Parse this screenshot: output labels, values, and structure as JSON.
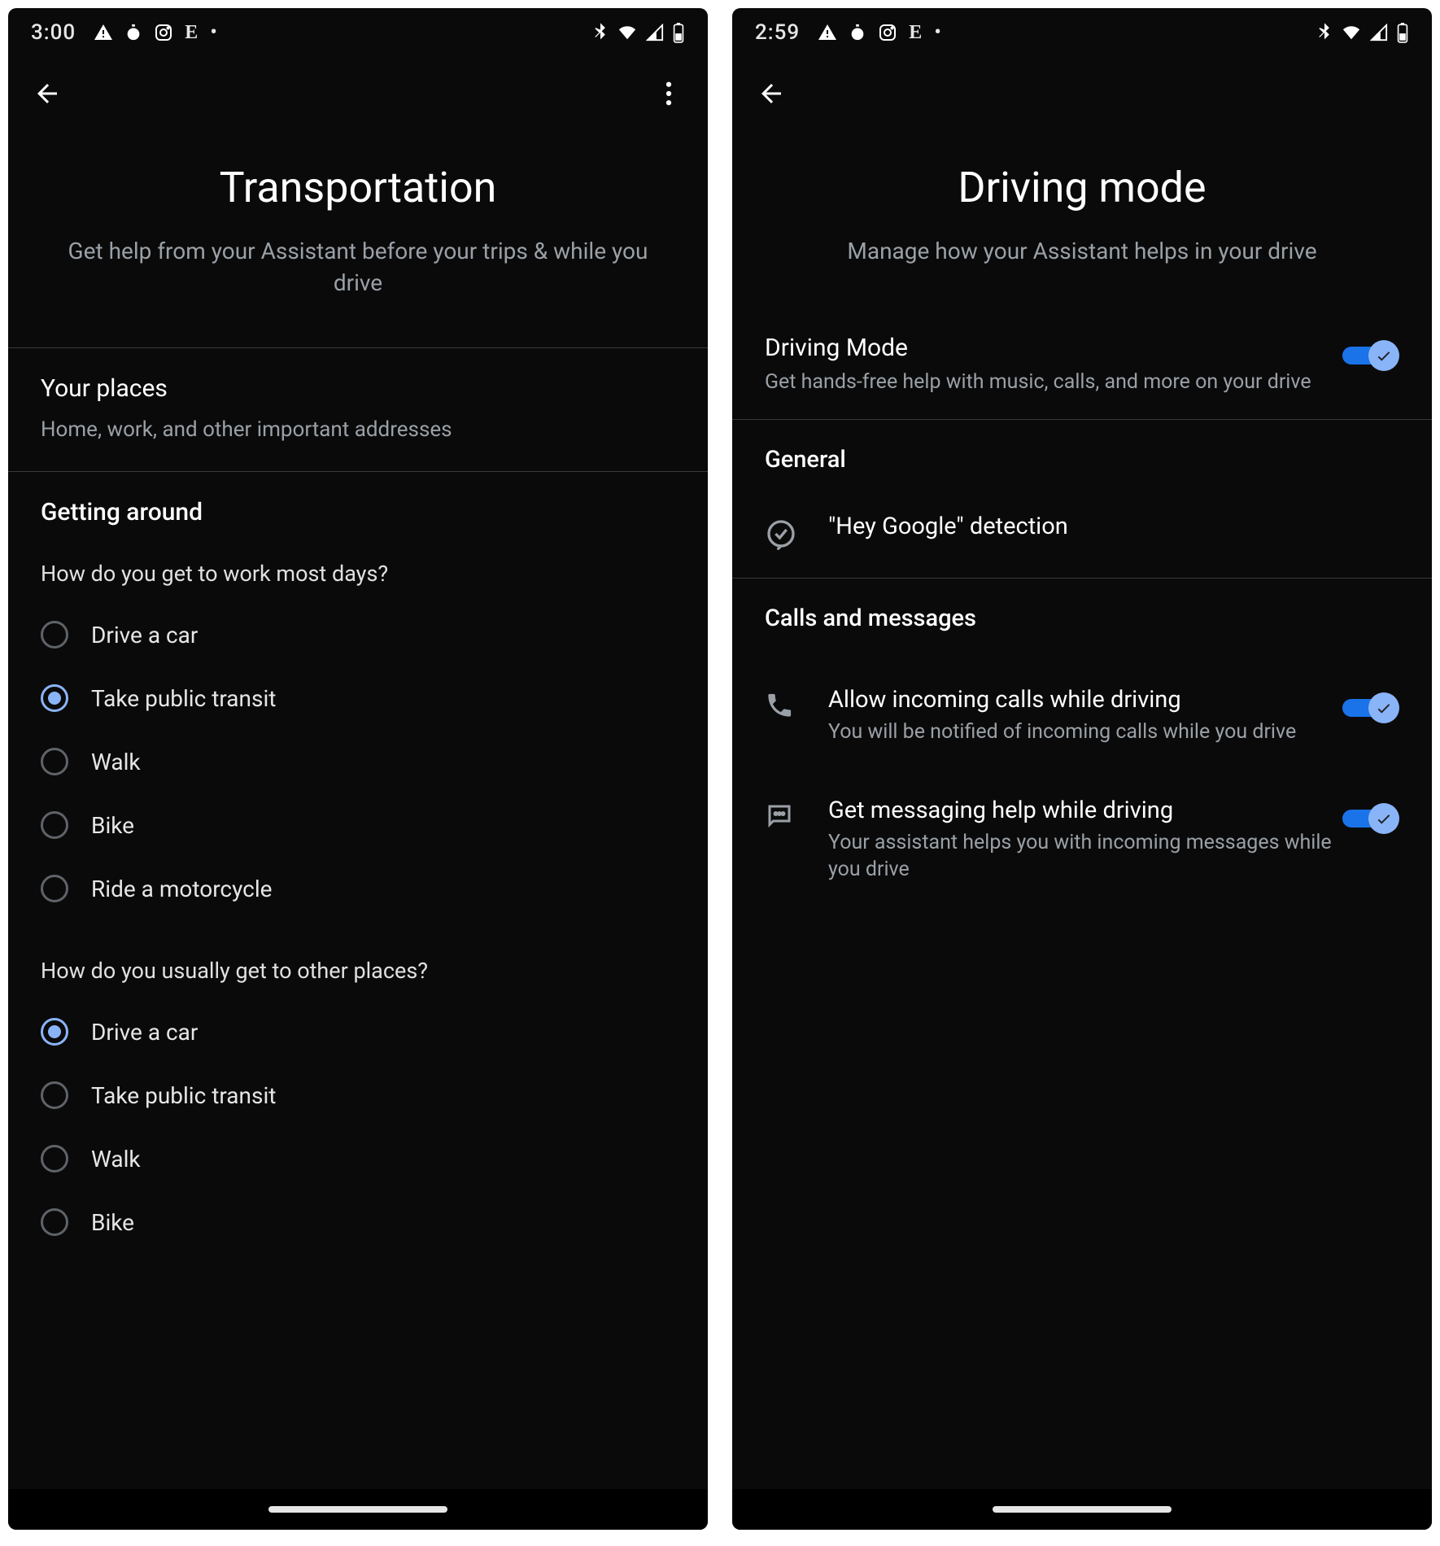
{
  "left": {
    "status": {
      "time": "3:00"
    },
    "title": "Transportation",
    "subtitle": "Get help from your Assistant before your trips & while you drive",
    "your_places": {
      "title": "Your places",
      "sub": "Home, work, and other important addresses"
    },
    "getting_around": {
      "title": "Getting around",
      "q1": "How do you get to work most days?",
      "q1_options": [
        "Drive a car",
        "Take public transit",
        "Walk",
        "Bike",
        "Ride a motorcycle"
      ],
      "q1_selected": 1,
      "q2": "How do you usually get to other places?",
      "q2_options": [
        "Drive a car",
        "Take public transit",
        "Walk",
        "Bike"
      ],
      "q2_selected": 0
    }
  },
  "right": {
    "status": {
      "time": "2:59"
    },
    "title": "Driving mode",
    "subtitle": "Manage how your Assistant helps in your drive",
    "driving_mode": {
      "title": "Driving Mode",
      "sub": "Get hands-free help with music, calls, and more on your drive",
      "on": true
    },
    "general": {
      "label": "General",
      "hey_google": "\"Hey Google\" detection"
    },
    "calls": {
      "label": "Calls and messages",
      "calls_title": "Allow incoming calls while driving",
      "calls_sub": "You will be notified of incoming calls while you drive",
      "calls_on": true,
      "msg_title": "Get messaging help while driving",
      "msg_sub": "Your assistant helps you with incoming messages while you drive",
      "msg_on": true
    }
  }
}
